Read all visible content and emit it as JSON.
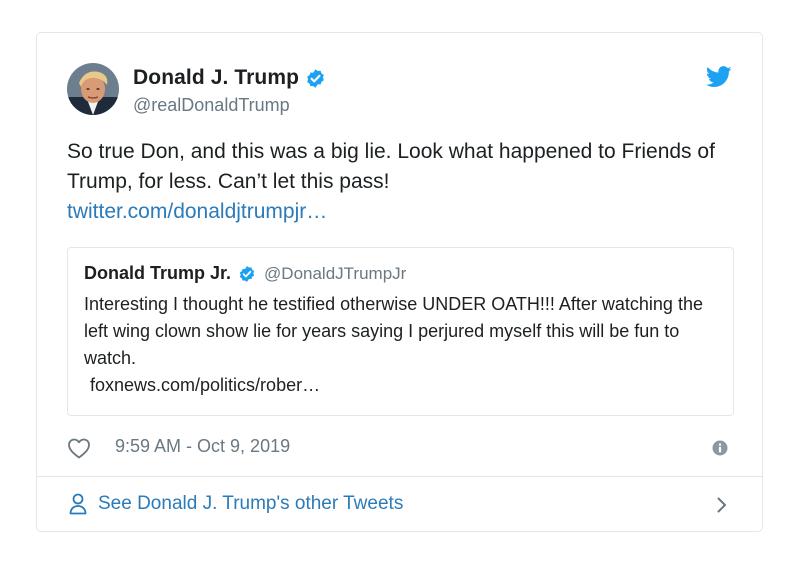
{
  "tweet": {
    "author": {
      "name": "Donald J. Trump",
      "handle": "@realDonaldTrump",
      "verified": true
    },
    "text": "So true Don, and this was a big lie. Look what happened to Friends of Trump, for less. Can’t let this pass!",
    "link": "twitter.com/donaldjtrumpjr…",
    "quoted": {
      "name": "Donald Trump Jr.",
      "handle": "@DonaldJTrumpJr",
      "verified": true,
      "text": "Interesting I thought he testified otherwise UNDER OATH!!! After watching the left wing clown show lie for years saying I perjured myself this will be fun to watch.",
      "link": "foxnews.com/politics/rober…"
    },
    "timestamp": "9:59 AM - Oct 9, 2019",
    "footer_label": "See Donald J. Trump's other Tweets"
  },
  "icons": {
    "logo": "twitter-bird-icon",
    "like": "heart-icon",
    "info": "info-icon",
    "profile": "person-icon",
    "more": "chevron-right-icon",
    "verified": "verified-badge-icon"
  },
  "colors": {
    "brand": "#1da1f2",
    "link": "#2b7bb9",
    "text": "#1c2022",
    "muted": "#697882",
    "border": "#e1e8ed"
  }
}
